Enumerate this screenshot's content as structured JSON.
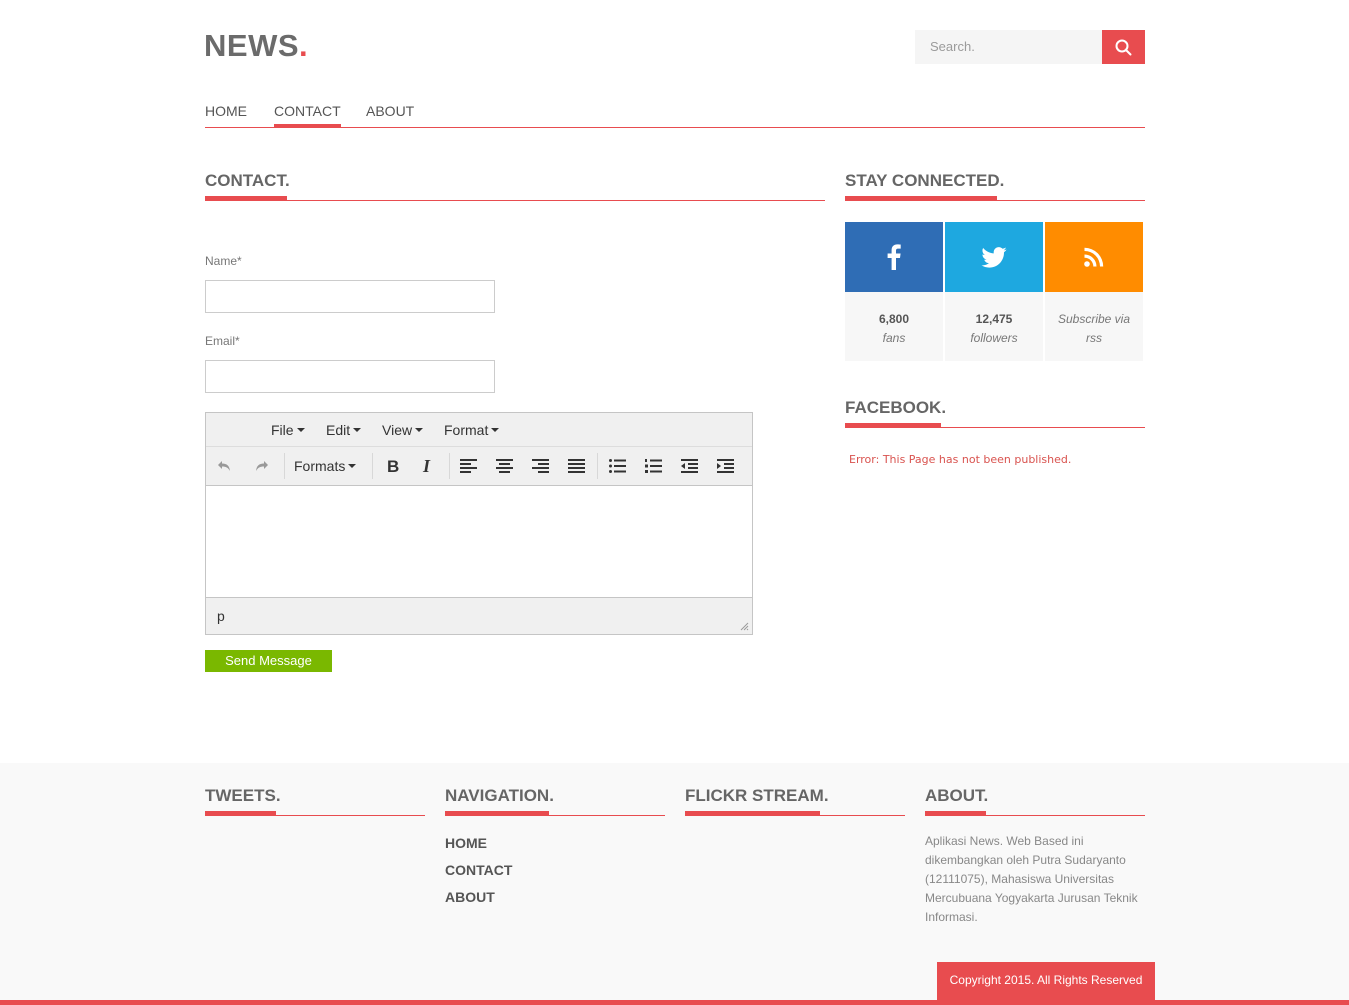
{
  "header": {
    "logo_text": "NEWS",
    "logo_dot": ".",
    "search_placeholder": "Search.",
    "accent": "#e84c4f"
  },
  "nav": {
    "items": [
      {
        "label": "HOME",
        "active": false
      },
      {
        "label": "CONTACT",
        "active": true
      },
      {
        "label": "ABOUT",
        "active": false
      }
    ]
  },
  "contact": {
    "title": "CONTACT.",
    "name_label": "Name*",
    "name_value": "",
    "email_label": "Email*",
    "email_value": "",
    "editor": {
      "menus": [
        "File",
        "Edit",
        "View",
        "Format"
      ],
      "formats_label": "Formats",
      "status_path": "p",
      "content": ""
    },
    "send_label": "Send Message"
  },
  "sidebar": {
    "stay_connected_title": "STAY CONNECTED.",
    "social": [
      {
        "icon": "facebook-icon",
        "count": "6,800",
        "unit": "fans",
        "color": "#2f6db5"
      },
      {
        "icon": "twitter-icon",
        "count": "12,475",
        "unit": "followers",
        "color": "#1ea8e0"
      },
      {
        "icon": "rss-icon",
        "count": "",
        "unit": "Subscribe via rss",
        "color": "#ff8c00"
      }
    ],
    "facebook_title": "FACEBOOK.",
    "facebook_error": "Error: This Page has not been published."
  },
  "footer": {
    "tweets_title": "TWEETS.",
    "navigation_title": "NAVIGATION.",
    "nav_links": [
      "HOME",
      "CONTACT",
      "ABOUT"
    ],
    "flickr_title": "FLICKR STREAM.",
    "about_title": "ABOUT.",
    "about_text": "Aplikasi News. Web Based ini dikembangkan oleh Putra Sudaryanto (12111075), Mahasiswa Universitas Mercubuana Yogyakarta Jurusan Teknik Informasi.",
    "copyright": "Copyright 2015. All Rights Reserved"
  }
}
